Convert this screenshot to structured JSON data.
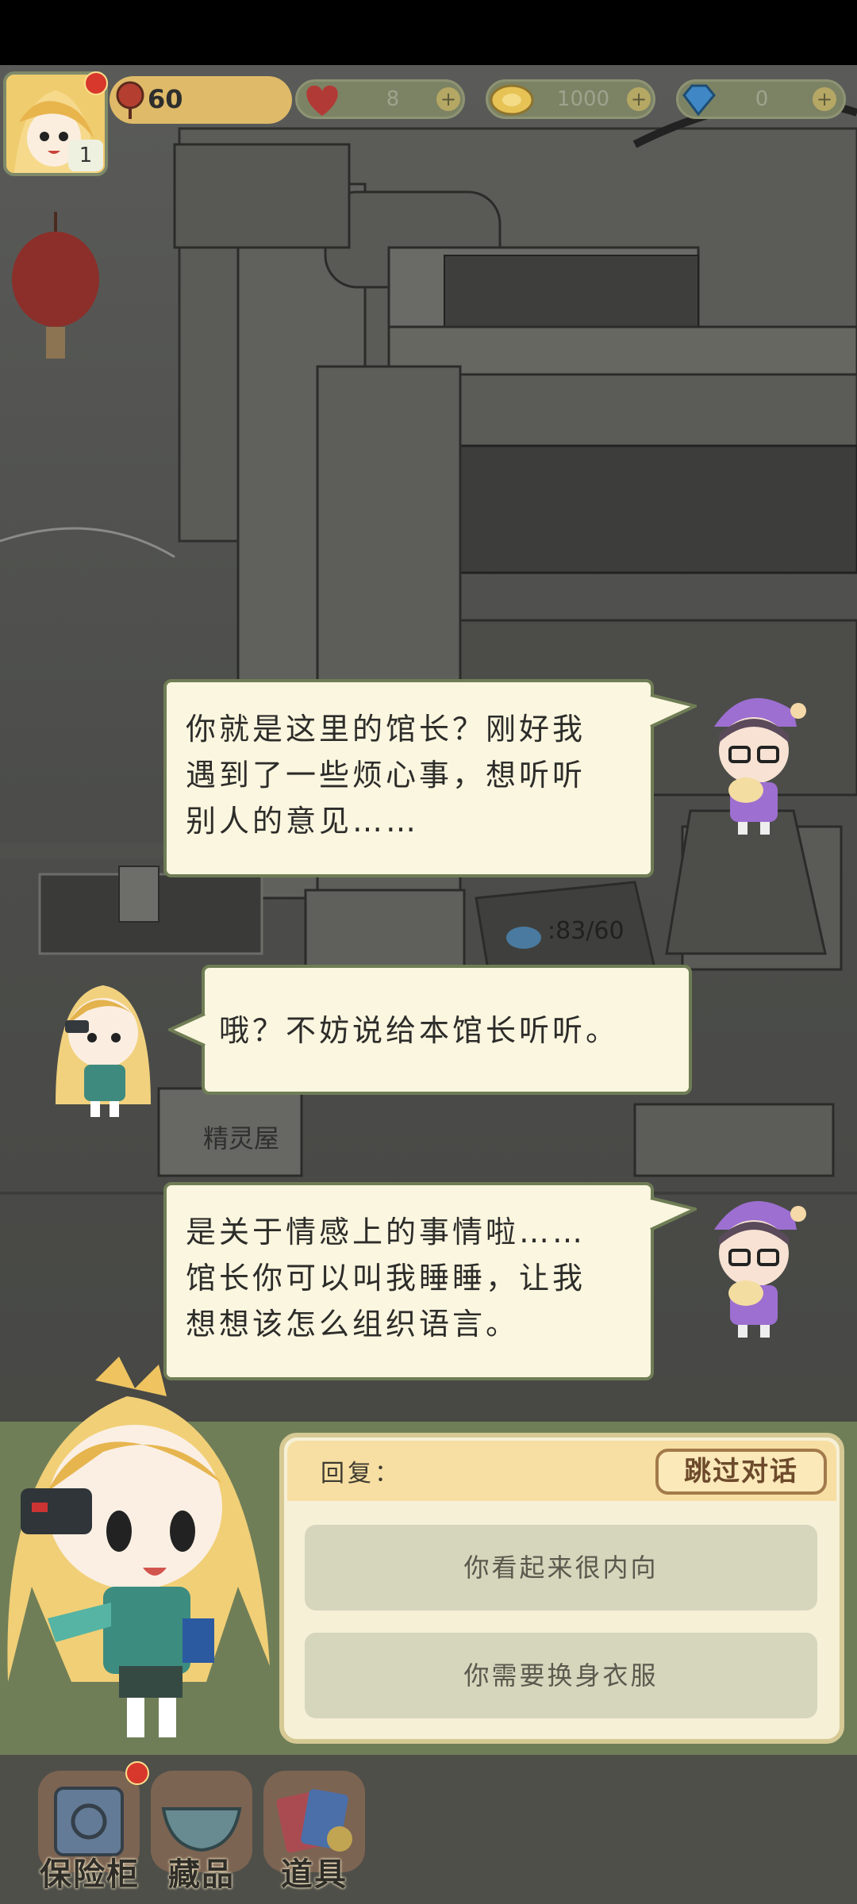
{
  "hud": {
    "energy": "60",
    "level": "1",
    "hearts": "8",
    "coins": "1000",
    "gems": "0",
    "add_symbol": "+"
  },
  "scene": {
    "sign": "精灵屋",
    "capacity": ":83/60"
  },
  "dialogue": [
    {
      "speaker": "visitor",
      "text_lines": [
        "你就是这里的馆长？刚好我",
        "遇到了一些烦心事，想听听",
        "别人的意见……"
      ]
    },
    {
      "speaker": "curator",
      "text_lines": [
        "哦？不妨说给本馆长听听。"
      ]
    },
    {
      "speaker": "visitor",
      "text_lines": [
        "是关于情感上的事情啦……",
        "馆长你可以叫我睡睡，让我",
        "想想该怎么组织语言。"
      ]
    }
  ],
  "reply_panel": {
    "label": "回复：",
    "skip_button": "跳过对话",
    "options": [
      "你看起来很内向",
      "你需要换身衣服"
    ]
  },
  "toolbar": {
    "items": [
      "保险柜",
      "藏品",
      "道具"
    ]
  },
  "colors": {
    "bubble_bg": "#fbf6df",
    "bubble_border": "#6f7d55",
    "panel_bg": "#6f7e57",
    "skip_border": "#a37a4b"
  }
}
